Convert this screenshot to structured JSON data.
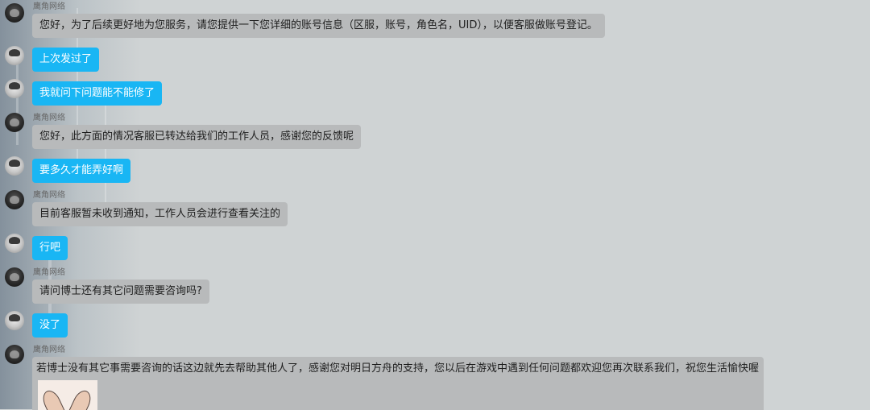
{
  "agent_name": "鹰角网络",
  "messages": [
    {
      "from": "agent",
      "text": "您好，为了后续更好地为您服务，请您提供一下您详细的账号信息（区服，账号，角色名，UID），以便客服做账号登记。"
    },
    {
      "from": "user",
      "text": "上次发过了"
    },
    {
      "from": "user",
      "text": "我就问下问题能不能修了"
    },
    {
      "from": "agent",
      "text": "您好，此方面的情况客服已转达给我们的工作人员，感谢您的反馈呢"
    },
    {
      "from": "user",
      "text": "要多久才能弄好啊"
    },
    {
      "from": "agent",
      "text": "目前客服暂未收到通知，工作人员会进行查看关注的"
    },
    {
      "from": "user",
      "text": "行吧"
    },
    {
      "from": "agent",
      "text": "请问博士还有其它问题需要咨询吗?"
    },
    {
      "from": "user",
      "text": "没了"
    },
    {
      "from": "agent",
      "text": "若博士没有其它事需要咨询的话这边就先去帮助其他人了，感谢您对明日方舟的支持，您以后在游戏中遇到任何问题都欢迎您再次联系我们，祝您生活愉快喔",
      "sticker": "bunny-sticker"
    }
  ],
  "colors": {
    "user_bubble": "#19b6f4",
    "agent_bubble": "#b8babb",
    "background": "#cfd3d4"
  }
}
